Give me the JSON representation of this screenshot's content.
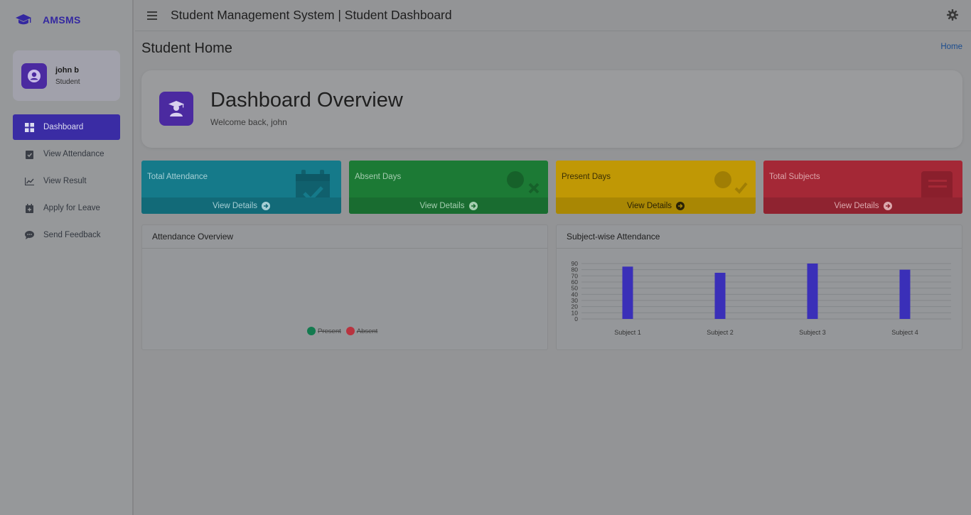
{
  "sidebar": {
    "brand": "AMSMS",
    "user": {
      "name": "john b",
      "role": "Student"
    },
    "items": [
      {
        "label": "Dashboard",
        "icon": "grid-icon",
        "active": true
      },
      {
        "label": "View Attendance",
        "icon": "checklist-icon",
        "active": false
      },
      {
        "label": "View Result",
        "icon": "chart-line-icon",
        "active": false
      },
      {
        "label": "Apply for Leave",
        "icon": "calendar-plus-icon",
        "active": false
      },
      {
        "label": "Send Feedback",
        "icon": "comment-icon",
        "active": false
      }
    ]
  },
  "topbar": {
    "title": "Student Management System | Student Dashboard"
  },
  "page": {
    "title": "Student Home",
    "breadcrumb": "Home"
  },
  "overview": {
    "title": "Dashboard Overview",
    "subtitle": "Welcome back, john"
  },
  "stats": [
    {
      "label": "Total Attendance",
      "link": "View Details",
      "icon": "calendar-check-icon",
      "color": "#157a8a"
    },
    {
      "label": "Absent Days",
      "link": "View Details",
      "icon": "user-times-icon",
      "color": "#1c7a35"
    },
    {
      "label": "Present Days",
      "link": "View Details",
      "icon": "user-check-icon",
      "color": "#c09805"
    },
    {
      "label": "Total Subjects",
      "link": "View Details",
      "icon": "book-icon",
      "color": "#a42836"
    }
  ],
  "cards": {
    "attendance_overview": {
      "title": "Attendance Overview",
      "legend": [
        {
          "name": "Present",
          "color": "#137a4f"
        },
        {
          "name": "Absent",
          "color": "#b8333f"
        }
      ]
    },
    "subject_attendance": {
      "title": "Subject-wise Attendance"
    }
  },
  "chart_data": {
    "type": "bar",
    "title": "",
    "categories": [
      "Subject 1",
      "Subject 2",
      "Subject 3",
      "Subject 4"
    ],
    "values": [
      85,
      75,
      90,
      80
    ],
    "ylim": [
      0,
      90
    ],
    "yticks": [
      0,
      10,
      20,
      30,
      40,
      50,
      60,
      70,
      80,
      90
    ],
    "grid": true,
    "bar_color": "#3a2fb8"
  }
}
